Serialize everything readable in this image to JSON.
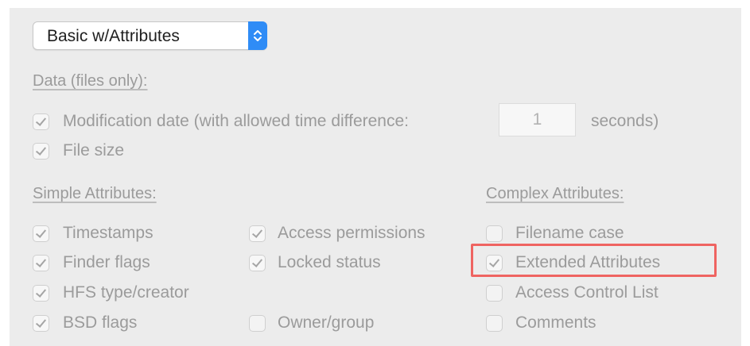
{
  "preset": {
    "selected": "Basic w/Attributes"
  },
  "data_section": {
    "heading": "Data (files only):",
    "modification_date_label": "Modification date (with allowed time difference:",
    "time_difference_value": "1",
    "seconds_label": "seconds)",
    "file_size_label": "File size",
    "modification_date_checked": true,
    "file_size_checked": true
  },
  "simple_attributes": {
    "heading": "Simple Attributes:",
    "items": [
      {
        "label": "Timestamps",
        "checked": true
      },
      {
        "label": "Access permissions",
        "checked": true
      },
      {
        "label": "Finder flags",
        "checked": true
      },
      {
        "label": "Locked status",
        "checked": true
      },
      {
        "label": "HFS type/creator",
        "checked": true
      },
      {
        "label": "BSD flags",
        "checked": true
      },
      {
        "label": "Owner/group",
        "checked": false
      }
    ]
  },
  "complex_attributes": {
    "heading": "Complex Attributes:",
    "items": [
      {
        "label": "Filename case",
        "checked": false
      },
      {
        "label": "Extended Attributes",
        "checked": true
      },
      {
        "label": "Access Control List",
        "checked": false
      },
      {
        "label": "Comments",
        "checked": false
      }
    ]
  },
  "colors": {
    "highlight": "#ef6461",
    "accent": "#2f8cf6",
    "panel": "#ececec"
  },
  "icons": {
    "popup": "up-down-chevron-icon",
    "check": "checkmark-icon"
  }
}
